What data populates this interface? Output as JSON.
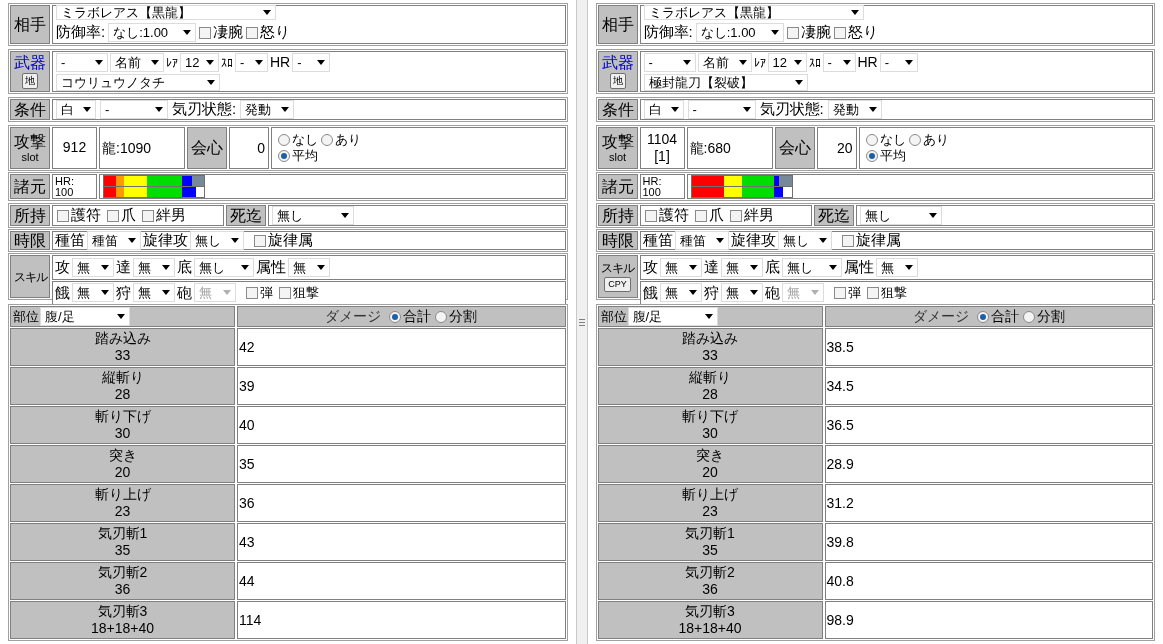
{
  "panels": [
    {
      "monster": {
        "label": "相手",
        "name": "ミラボレアス【黒龍】",
        "defense_label": "防御率:",
        "defense": "なし:1.00",
        "options": [
          {
            "label": "凄腕",
            "checked": false
          },
          {
            "label": "怒り",
            "checked": false
          }
        ]
      },
      "weapon": {
        "label": "武器",
        "button": "地",
        "type": "-",
        "sort": "名前",
        "rarity_label": "ﾚｱ",
        "rarity": "12",
        "slot_label": "ｽﾛ",
        "slot": "-",
        "hr_label": "HR",
        "hr": "-",
        "name": "コウリュウノタチ"
      },
      "condition": {
        "label": "条件",
        "sharpness": "白",
        "select_2": "-",
        "spirit_label": "気刃状態:",
        "spirit": "発動"
      },
      "attack": {
        "label": "攻撃",
        "sublabel": "slot",
        "value_lines": [
          "912"
        ],
        "element": "龍:1090",
        "affinity_label": "会心",
        "affinity": "0",
        "crit_options": [
          {
            "label": "なし",
            "selected": false
          },
          {
            "label": "あり",
            "selected": false
          },
          {
            "label": "平均",
            "selected": true
          }
        ]
      },
      "specs": {
        "label": "諸元",
        "hr_lines": [
          "HR:",
          "100"
        ]
      },
      "items": {
        "label": "所持",
        "checks": [
          {
            "label": "護符",
            "checked": false
          },
          {
            "label": "爪",
            "checked": false
          },
          {
            "label": "絆男",
            "checked": false
          }
        ],
        "death_label": "死迄",
        "death": "無し"
      },
      "timed": {
        "label": "時限",
        "fields": [
          {
            "label": "種笛",
            "value": "種笛"
          },
          {
            "label": "旋律攻",
            "value": "無し"
          }
        ],
        "check": {
          "label": "旋律属",
          "checked": false
        }
      },
      "skills": {
        "label": "スキル",
        "rows": [
          {
            "fields": [
              {
                "label": "攻",
                "value": "無",
                "disabled": false
              },
              {
                "label": "達",
                "value": "無",
                "disabled": false
              },
              {
                "label": "底",
                "value": "無し",
                "disabled": false
              },
              {
                "label": "属性",
                "value": "無",
                "disabled": false
              }
            ],
            "checks": []
          },
          {
            "fields": [
              {
                "label": "餓",
                "value": "無",
                "disabled": false
              },
              {
                "label": "狩",
                "value": "無",
                "disabled": false
              },
              {
                "label": "砲",
                "value": "無",
                "disabled": true
              }
            ],
            "checks": [
              {
                "label": "弾",
                "checked": false
              },
              {
                "label": "狙撃",
                "checked": false
              }
            ]
          }
        ]
      },
      "table": {
        "part_label": "部位",
        "part": "腹/足",
        "damage_label": "ダメージ",
        "modes": [
          {
            "label": "合計",
            "selected": true
          },
          {
            "label": "分割",
            "selected": false
          }
        ],
        "rows": [
          {
            "name": "踏み込み",
            "motion": "33",
            "damage": "42"
          },
          {
            "name": "縦斬り",
            "motion": "28",
            "damage": "39"
          },
          {
            "name": "斬り下げ",
            "motion": "30",
            "damage": "40"
          },
          {
            "name": "突き",
            "motion": "20",
            "damage": "35"
          },
          {
            "name": "斬り上げ",
            "motion": "23",
            "damage": "36"
          },
          {
            "name": "気刃斬1",
            "motion": "35",
            "damage": "43"
          },
          {
            "name": "気刃斬2",
            "motion": "36",
            "damage": "44"
          },
          {
            "name": "気刃斬3",
            "motion": "18+18+40",
            "damage": "114"
          }
        ]
      }
    },
    {
      "monster": {
        "label": "相手",
        "name": "ミラボレアス【黒龍】",
        "defense_label": "防御率:",
        "defense": "なし:1.00",
        "options": [
          {
            "label": "凄腕",
            "checked": false
          },
          {
            "label": "怒り",
            "checked": false
          }
        ]
      },
      "weapon": {
        "label": "武器",
        "button": "地",
        "type": "-",
        "sort": "名前",
        "rarity_label": "ﾚｱ",
        "rarity": "12",
        "slot_label": "ｽﾛ",
        "slot": "-",
        "hr_label": "HR",
        "hr": "-",
        "name": "極封龍刀【裂破】"
      },
      "condition": {
        "label": "条件",
        "sharpness": "白",
        "select_2": "-",
        "spirit_label": "気刃状態:",
        "spirit": "発動"
      },
      "attack": {
        "label": "攻撃",
        "sublabel": "slot",
        "value_lines": [
          "1104",
          "[1]"
        ],
        "element": "龍:680",
        "affinity_label": "会心",
        "affinity": "20",
        "crit_options": [
          {
            "label": "なし",
            "selected": false
          },
          {
            "label": "あり",
            "selected": false
          },
          {
            "label": "平均",
            "selected": true
          }
        ]
      },
      "specs": {
        "label": "諸元",
        "hr_lines": [
          "HR:",
          "100"
        ]
      },
      "items": {
        "label": "所持",
        "checks": [
          {
            "label": "護符",
            "checked": false
          },
          {
            "label": "爪",
            "checked": false
          },
          {
            "label": "絆男",
            "checked": false
          }
        ],
        "death_label": "死迄",
        "death": "無し"
      },
      "timed": {
        "label": "時限",
        "fields": [
          {
            "label": "種笛",
            "value": "種笛"
          },
          {
            "label": "旋律攻",
            "value": "無し"
          }
        ],
        "check": {
          "label": "旋律属",
          "checked": false
        }
      },
      "skills": {
        "label": "スキル",
        "button": "CPY",
        "rows": [
          {
            "fields": [
              {
                "label": "攻",
                "value": "無",
                "disabled": false
              },
              {
                "label": "達",
                "value": "無",
                "disabled": false
              },
              {
                "label": "底",
                "value": "無し",
                "disabled": false
              },
              {
                "label": "属性",
                "value": "無",
                "disabled": false
              }
            ],
            "checks": []
          },
          {
            "fields": [
              {
                "label": "餓",
                "value": "無",
                "disabled": false
              },
              {
                "label": "狩",
                "value": "無",
                "disabled": false
              },
              {
                "label": "砲",
                "value": "無",
                "disabled": true
              }
            ],
            "checks": [
              {
                "label": "弾",
                "checked": false
              },
              {
                "label": "狙撃",
                "checked": false
              }
            ]
          }
        ]
      },
      "table": {
        "part_label": "部位",
        "part": "腹/足",
        "damage_label": "ダメージ",
        "modes": [
          {
            "label": "合計",
            "selected": true
          },
          {
            "label": "分割",
            "selected": false
          }
        ],
        "rows": [
          {
            "name": "踏み込み",
            "motion": "33",
            "damage": "38.5"
          },
          {
            "name": "縦斬り",
            "motion": "28",
            "damage": "34.5"
          },
          {
            "name": "斬り下げ",
            "motion": "30",
            "damage": "36.5"
          },
          {
            "name": "突き",
            "motion": "20",
            "damage": "28.9"
          },
          {
            "name": "斬り上げ",
            "motion": "23",
            "damage": "31.2"
          },
          {
            "name": "気刃斬1",
            "motion": "35",
            "damage": "39.8"
          },
          {
            "name": "気刃斬2",
            "motion": "36",
            "damage": "40.8"
          },
          {
            "name": "気刃斬3",
            "motion": "18+18+40",
            "damage": "98.9"
          }
        ]
      }
    }
  ]
}
